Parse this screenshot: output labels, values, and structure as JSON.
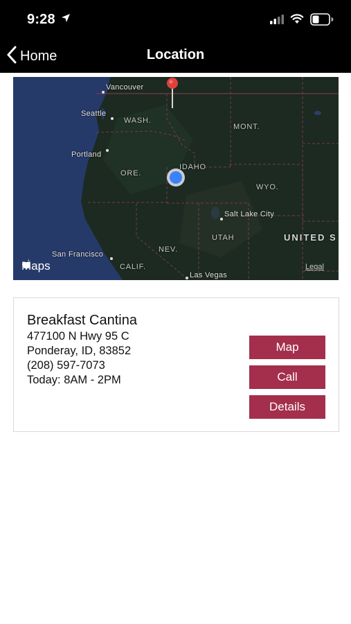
{
  "status_bar": {
    "time": "9:28",
    "icons": [
      "location-arrow-icon",
      "cellular-signal-icon",
      "wifi-icon",
      "battery-icon"
    ]
  },
  "nav": {
    "back_label": "Home",
    "title": "Location"
  },
  "map": {
    "labels": {
      "vancouver": "Vancouver",
      "seattle": "Seattle",
      "wash": "WASH.",
      "mont": "MONT.",
      "portland": "Portland",
      "ore": "ORE.",
      "idaho": "IDAHO",
      "wyo": "WYO.",
      "salt_lake": "Salt Lake City",
      "utah": "UTAH",
      "nev": "NEV.",
      "united": "UNITED S",
      "san_francisco": "San Francisco",
      "calif": "CALIF.",
      "las_vegas": "Las Vegas"
    },
    "brand": "Maps",
    "legal": "Legal"
  },
  "location": {
    "name": "Breakfast Cantina",
    "address1": "477100 N Hwy 95 C",
    "address2": "Ponderay, ID, 83852",
    "phone": "(208) 597-7073",
    "hours": "Today: 8AM - 2PM"
  },
  "buttons": {
    "map": "Map",
    "call": "Call",
    "details": "Details"
  },
  "colors": {
    "accent": "#a32f4c",
    "bar": "#000000"
  }
}
